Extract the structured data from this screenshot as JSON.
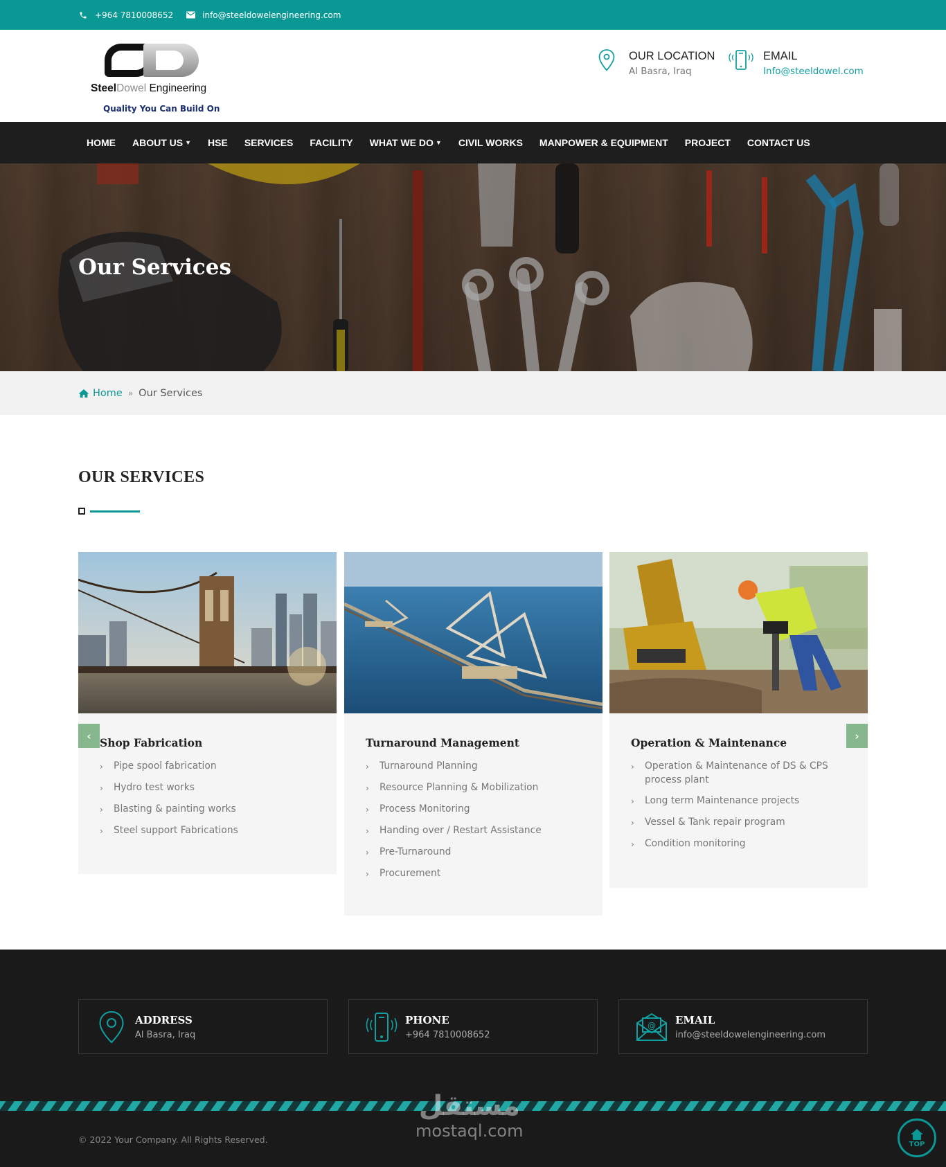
{
  "topbar": {
    "phone": "+964 7810008652",
    "email": "info@steeldowelengineering.com",
    "background": "#0a9895"
  },
  "logo": {
    "name_part1": "Steel",
    "name_part2": "Dowel",
    "name_part3": " Engineering",
    "tagline": "Quality You Can Build On"
  },
  "header": {
    "location_title": "OUR LOCATION",
    "location_value": "Al Basra, Iraq",
    "email_title": "EMAIL",
    "email_value": "Info@steeldowel.com"
  },
  "nav": {
    "items": [
      {
        "label": "HOME"
      },
      {
        "label": "ABOUT US"
      },
      {
        "label": "HSE"
      },
      {
        "label": "SERVICES"
      },
      {
        "label": "FACILITY"
      },
      {
        "label": "WHAT WE DO"
      },
      {
        "label": "CIVIL WORKS"
      },
      {
        "label": "MANPOWER & EQUIPMENT"
      },
      {
        "label": "PROJECT"
      },
      {
        "label": "CONTACT US"
      }
    ]
  },
  "banner": {
    "title": "Our Services"
  },
  "breadcrumb": {
    "home": "Home",
    "current": "Our Services"
  },
  "section": {
    "title": "OUR SERVICES"
  },
  "services": [
    {
      "title": "Shop Fabrication",
      "items": [
        "Pipe spool fabrication",
        "Hydro test works",
        "Blasting & painting works",
        "Steel support Fabrications"
      ]
    },
    {
      "title": "Turnaround Management",
      "items": [
        "Turnaround Planning",
        "Resource Planning & Mobilization",
        "Process Monitoring",
        "Handing over / Restart Assistance",
        "Pre-Turnaround",
        "Procurement"
      ]
    },
    {
      "title": "Operation & Maintenance",
      "items": [
        "Operation & Maintenance of DS & CPS process plant",
        "Long term Maintenance projects",
        "Vessel & Tank repair program",
        "Condition monitoring"
      ]
    }
  ],
  "footer": {
    "address_title": "ADDRESS",
    "address_value": "Al Basra, Iraq",
    "phone_title": "PHONE",
    "phone_value": "+964 7810008652",
    "email_title": "EMAIL",
    "email_value": "info@steeldowelengineering.com",
    "copyright": "© 2022 Your Company. All Rights Reserved.",
    "watermark_ar": "مستقل",
    "watermark_en": "mostaql.com",
    "top_label": "TOP"
  },
  "colors": {
    "accent": "#0a9895",
    "nav_bg": "#1e1e1e",
    "footer_bg": "#1a1a1a",
    "arrow": "#86b78d"
  }
}
